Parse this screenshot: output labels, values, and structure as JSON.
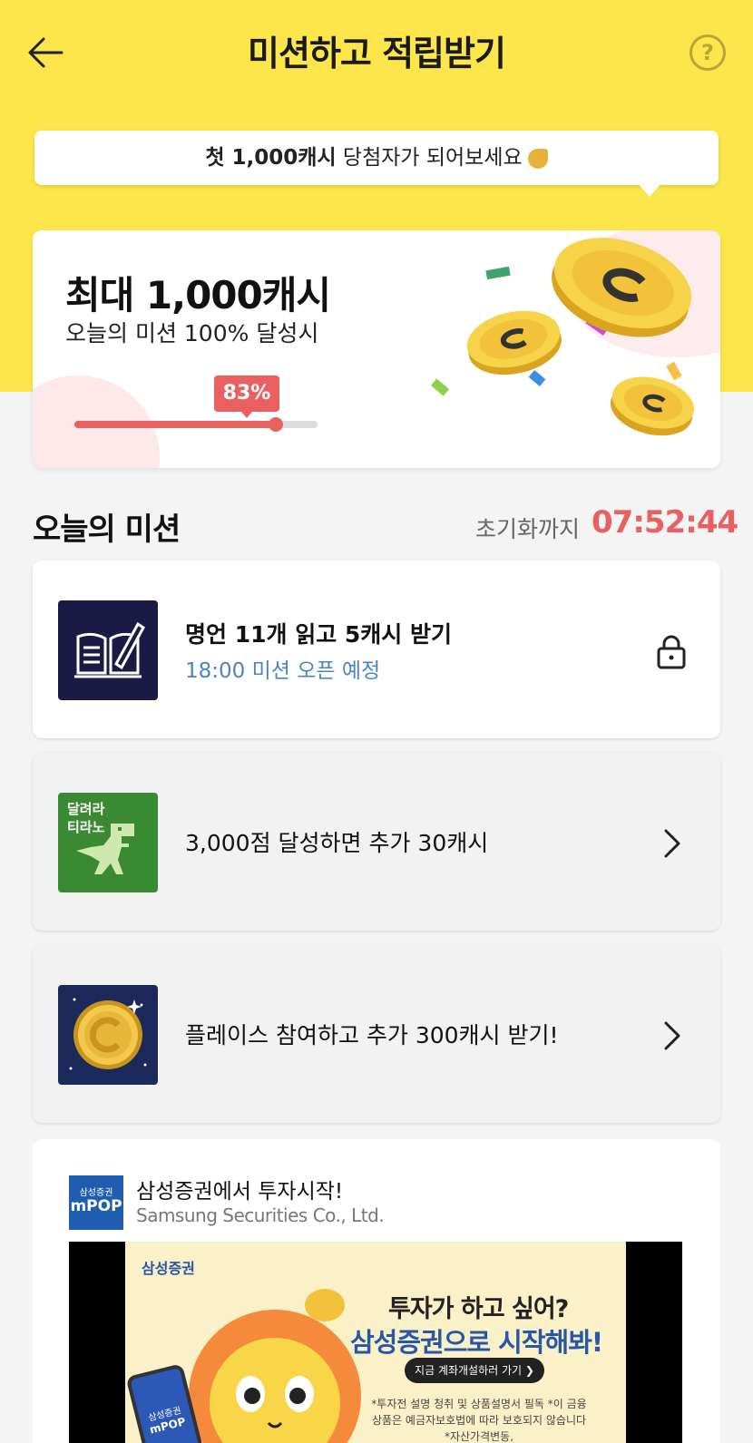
{
  "header": {
    "title": "미션하고 적립받기",
    "help_label": "?"
  },
  "bubble": {
    "highlight": "첫 1,000캐시",
    "text": " 당첨자가 되어보세요"
  },
  "reward": {
    "title": "최대 1,000캐시",
    "subtitle": "오늘의 미션 100% 달성시",
    "progress_label": "83%",
    "progress": 0.83
  },
  "missions_section": {
    "title": "오늘의 미션",
    "reset_label": "초기화까지",
    "reset_time": "07:52:44"
  },
  "missions": [
    {
      "title": "명언 11개 읽고 5캐시 받기",
      "subtitle": "18:00 미션 오픈 예정",
      "icon": "book-pen-icon",
      "right_icon": "lock-icon"
    },
    {
      "title": "3,000점 달성하면 추가 30캐시",
      "icon": "dinosaur-game-icon",
      "thumb_line1": "달려라",
      "thumb_line2": "티라노",
      "right_icon": "chevron-right-icon"
    },
    {
      "title": "플레이스 참여하고 추가 300캐시 받기!",
      "icon": "gold-coin-icon",
      "right_icon": "chevron-right-icon"
    }
  ],
  "ad": {
    "logo_line1": "삼성증권",
    "logo_line2": "mPOP",
    "title": "삼성증권에서 투자시작!",
    "company": "Samsung Securities Co., Ltd.",
    "banner_brand": "삼성증권",
    "banner_head1": "투자가 하고 싶어?",
    "banner_head2": "삼성증권으로 시작해봐!",
    "banner_cta": "지금 계좌개설하러 가기 ❯",
    "banner_notice": "*투자전 설명 청취 및 상품설명서 필독 *이 금융상품은 예금자보호법에 따라 보호되지 않습니다 *자산가격변동,",
    "phone_line1": "삼성증권",
    "phone_line2": "mPOP"
  },
  "colors": {
    "header_bg": "#fde64b",
    "accent_red": "#e86060",
    "link_blue": "#4b86c4"
  }
}
